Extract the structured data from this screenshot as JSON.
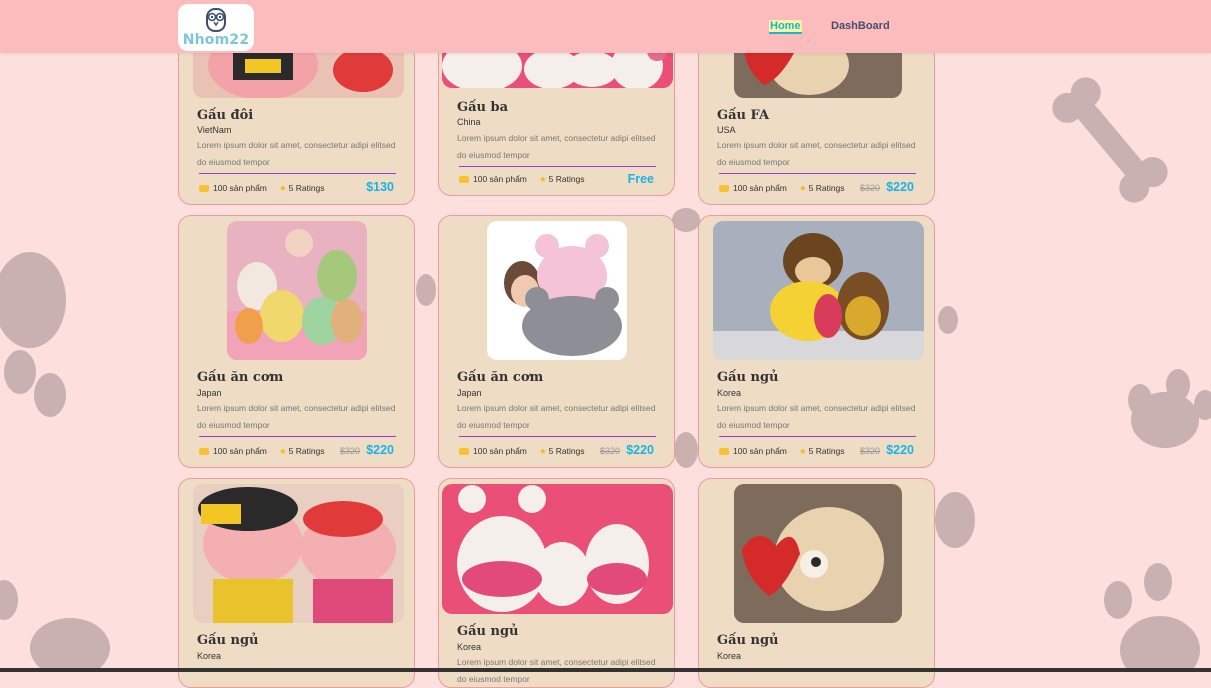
{
  "header": {
    "logo_text": "Nhom22",
    "nav": [
      {
        "label": "Home",
        "active": true
      },
      {
        "label": "DashBoard",
        "active": false
      }
    ]
  },
  "colors": {
    "header": "#fbbcbe",
    "page": "#fde0dd",
    "card": "#efdcc4",
    "price": "#1ab3e6",
    "rule": "#9a3bd8"
  },
  "products": [
    {
      "title": "Gấu đôi",
      "origin": "VietNam",
      "desc": "Lorem ipsum dolor sit amet, consectetur adipi elitsed do eiusmod tempor",
      "stock": "100 sản phẩm",
      "ratings": "5 Ratings",
      "old_price": "",
      "price": "$130",
      "image": "pig-plush-icon"
    },
    {
      "title": "Gấu ba",
      "origin": "China",
      "desc": "Lorem ipsum dolor sit amet, consectetur adipi elitsed do eiusmod tempor",
      "stock": "100 sản phẩm",
      "ratings": "5 Ratings",
      "old_price": "",
      "price": "Free",
      "image": "white-bears-icon"
    },
    {
      "title": "Gấu FA",
      "origin": "USA",
      "desc": "Lorem ipsum dolor sit amet, consectetur adipi elitsed do eiusmod tempor",
      "stock": "100 sản phẩm",
      "ratings": "5 Ratings",
      "old_price": "$320",
      "price": "$220",
      "image": "heart-bear-icon"
    },
    {
      "title": "Gấu ăn cơm",
      "origin": "Japan",
      "desc": "Lorem ipsum dolor sit amet, consectetur adipi elitsed do eiusmod tempor",
      "stock": "100 sản phẩm",
      "ratings": "5 Ratings",
      "old_price": "$320",
      "price": "$220",
      "image": "plush-store-icon"
    },
    {
      "title": "Gấu ăn cơm",
      "origin": "Japan",
      "desc": "Lorem ipsum dolor sit amet, consectetur adipi elitsed do eiusmod tempor",
      "stock": "100 sản phẩm",
      "ratings": "5 Ratings",
      "old_price": "$320",
      "price": "$220",
      "image": "mouse-plush-icon"
    },
    {
      "title": "Gấu ngủ",
      "origin": "Korea",
      "desc": "Lorem ipsum dolor sit amet, consectetur adipi elitsed do eiusmod tempor",
      "stock": "100 sản phẩm",
      "ratings": "5 Ratings",
      "old_price": "$320",
      "price": "$220",
      "image": "monkey-plush-icon"
    },
    {
      "title": "Gấu ngủ",
      "origin": "Korea",
      "image": "pig-plush-icon"
    },
    {
      "title": "Gấu ngủ",
      "origin": "Korea",
      "desc": "Lorem ipsum dolor sit amet, consectetur adipi elitsed do eiusmod tempor",
      "image": "white-bears-icon"
    },
    {
      "title": "Gấu ngủ",
      "origin": "Korea",
      "image": "heart-bear-icon"
    }
  ]
}
